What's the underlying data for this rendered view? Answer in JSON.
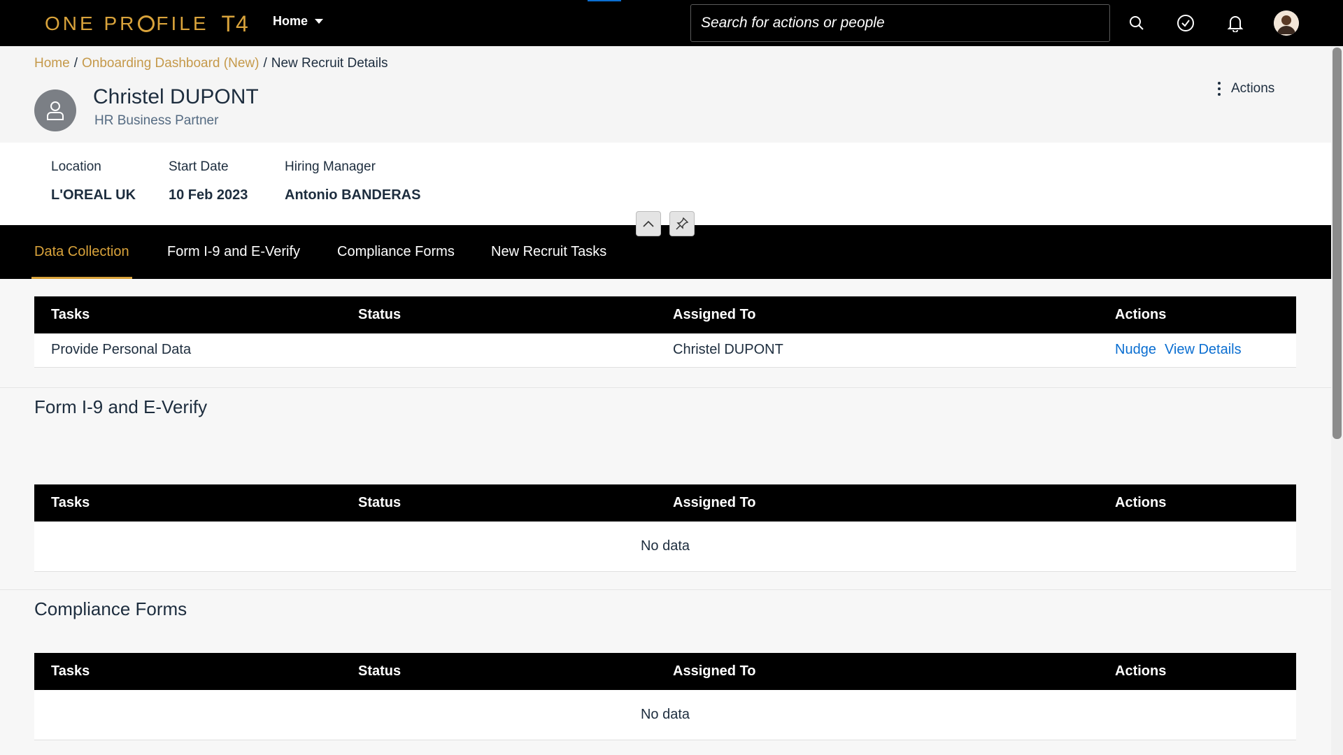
{
  "shell": {
    "logo_text_a": "ONE PR",
    "logo_text_b": "FILE",
    "logo_suffix": "T4",
    "home_menu_label": "Home",
    "search_placeholder": "Search for actions or people"
  },
  "header": {
    "breadcrumb": [
      {
        "label": "Home"
      },
      {
        "label": "Onboarding Dashboard (New)"
      },
      {
        "label": "New Recruit Details"
      }
    ],
    "breadcrumb_sep": "/",
    "name": "Christel DUPONT",
    "title": "HR Business Partner",
    "actions_label": "Actions",
    "attributes": [
      {
        "label": "Location",
        "value": "L'OREAL UK"
      },
      {
        "label": "Start Date",
        "value": "10 Feb 2023"
      },
      {
        "label": "Hiring Manager",
        "value": "Antonio BANDERAS"
      }
    ]
  },
  "tabs": [
    {
      "label": "Data Collection",
      "active": true
    },
    {
      "label": "Form I-9 and E-Verify",
      "active": false
    },
    {
      "label": "Compliance Forms",
      "active": false
    },
    {
      "label": "New Recruit Tasks",
      "active": false
    }
  ],
  "table_columns": [
    "Tasks",
    "Status",
    "Assigned To",
    "Actions"
  ],
  "sections": {
    "data_collection": {
      "rows": [
        {
          "task": "Provide Personal Data",
          "status": "",
          "assigned_to": "Christel DUPONT",
          "actions": [
            "Nudge",
            "View Details"
          ]
        }
      ]
    },
    "form_i9": {
      "title": "Form I-9 and E-Verify",
      "empty_text": "No data"
    },
    "compliance": {
      "title": "Compliance Forms",
      "empty_text": "No data"
    }
  },
  "colors": {
    "brand_gold": "#d9a33b",
    "link_blue": "#0a6ed1",
    "shell_bg": "#000000"
  }
}
